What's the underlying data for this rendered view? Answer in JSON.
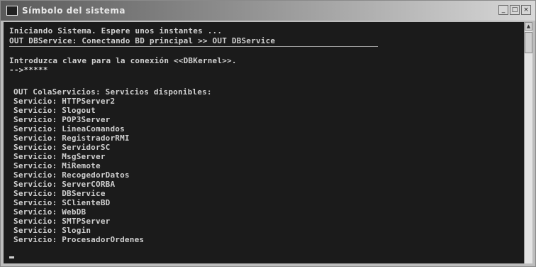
{
  "window": {
    "title": "Símbolo del sistema"
  },
  "controls": {
    "minimize": "_",
    "maximize": "□",
    "close": "×"
  },
  "console": {
    "header_lines": [
      "Iniciando Sistema. Espere unos instantes ...",
      "OUT DBService: Conectando BD principal >> OUT DBService"
    ],
    "prompt_line": "Introduzca clave para la conexión <<DBKernel>>.",
    "input_line": "-->*****",
    "services_header": "OUT ColaServicios: Servicios disponibles:",
    "service_prefix": "Servicio:",
    "services": [
      "HTTPServer2",
      "Slogout",
      "POP3Server",
      "LineaComandos",
      "RegistradorRMI",
      "ServidorSC",
      "MsgServer",
      "MiRemote",
      "RecogedorDatos",
      "ServerCORBA",
      "DBService",
      "SClienteBD",
      "WebDB",
      "SMTPServer",
      "Slogin",
      "ProcesadorOrdenes"
    ]
  },
  "scrollbar": {
    "up_arrow": "▲"
  }
}
